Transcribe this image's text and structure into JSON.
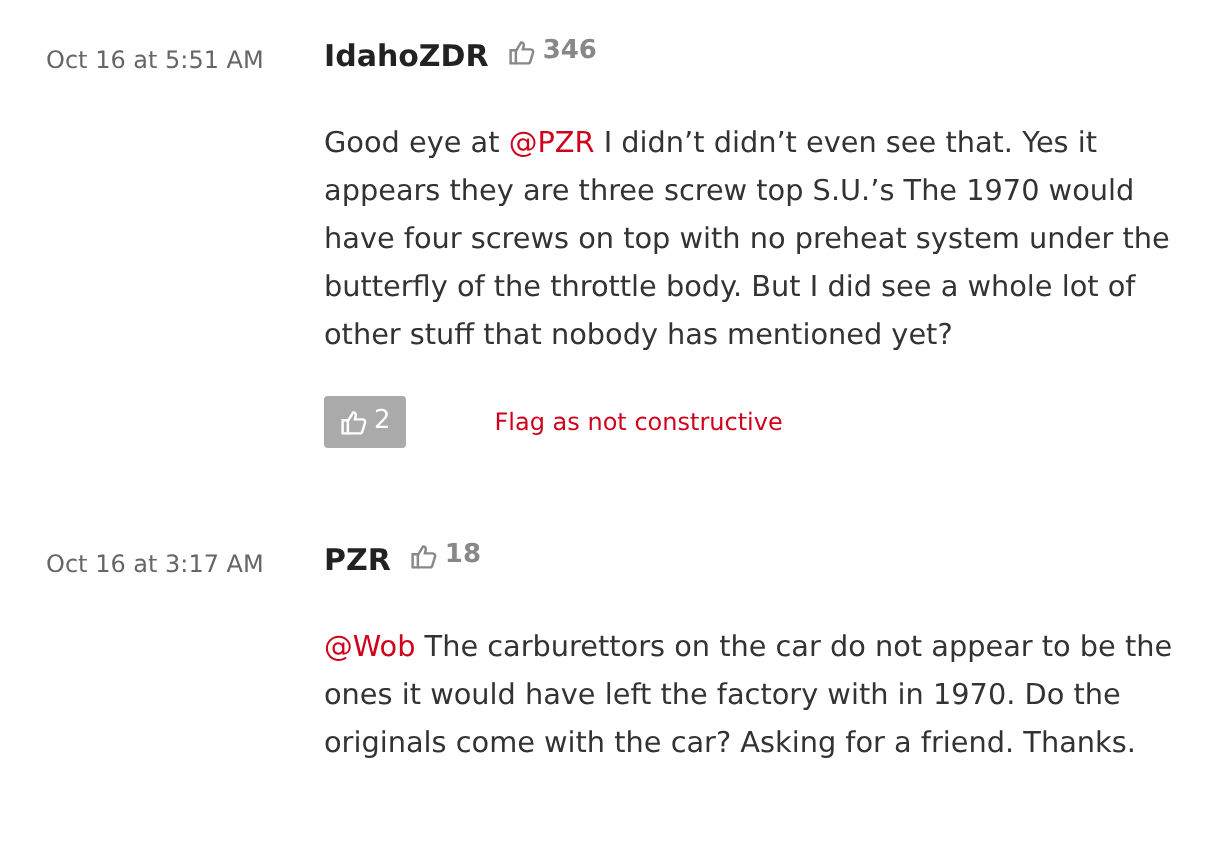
{
  "comments": [
    {
      "time": "Oct 16 at 5:51 AM",
      "author": "IdahoZDR",
      "likes": "346",
      "mention": "@PZR",
      "text": " I didn’t didn’t even see that. Yes it appears they are three screw top S.U.’s The 1970 would have four screws on top with no preheat system under the butterfly of the throttle body. But I did see a whole lot of other stuff that nobody has mentioned yet?",
      "prefix": "Good eye at ",
      "vote_count": "2",
      "flag": "Flag as not constructive"
    },
    {
      "time": "Oct 16 at 3:17 AM",
      "author": "PZR",
      "likes": "18",
      "mention": "@Wob",
      "text": " The carburettors on the car do not appear to be the ones it would have left the factory with in 1970. Do the originals come with the car? Asking for a friend. Thanks."
    }
  ]
}
